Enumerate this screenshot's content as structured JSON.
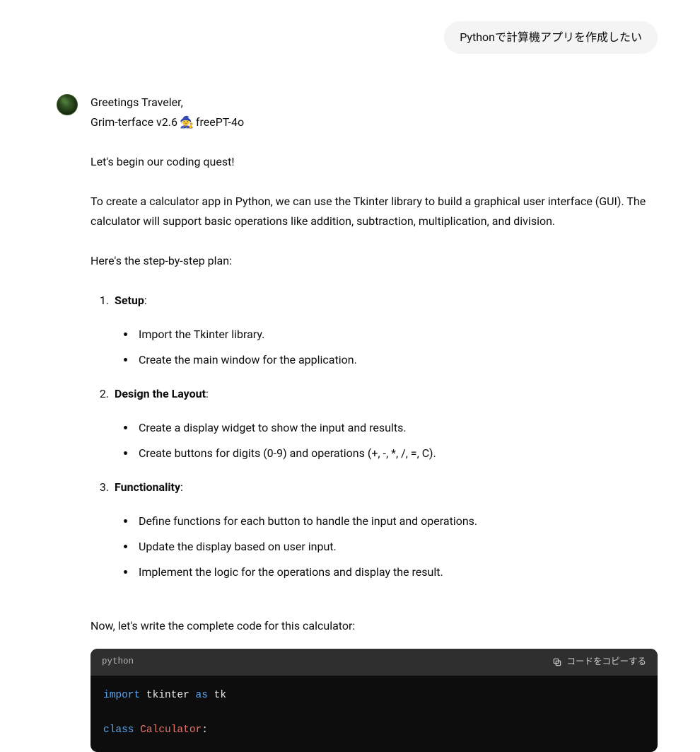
{
  "user": {
    "message": "Pythonで計算機アプリを作成したい"
  },
  "assistant": {
    "greeting_line1": "Greetings Traveler,",
    "greeting_line2_pre": "Grim-terface v2.6 ",
    "greeting_line2_post": " freePT-4o",
    "quest": "Let's begin our coding quest!",
    "intro": "To create a calculator app in Python, we can use the Tkinter library to build a graphical user interface (GUI). The calculator will support basic operations like addition, subtraction, multiplication, and division.",
    "plan_intro": "Here's the step-by-step plan:",
    "steps": [
      {
        "title": "Setup",
        "items": [
          "Import the Tkinter library.",
          "Create the main window for the application."
        ]
      },
      {
        "title": "Design the Layout",
        "items": [
          "Create a display widget to show the input and results.",
          "Create buttons for digits (0-9) and operations (+, -, *, /, =, C)."
        ]
      },
      {
        "title": "Functionality",
        "items": [
          "Define functions for each button to handle the input and operations.",
          "Update the display based on user input.",
          "Implement the logic for the operations and display the result."
        ]
      }
    ],
    "code_intro": "Now, let's write the complete code for this calculator:"
  },
  "code": {
    "language": "python",
    "copy_label": "コードをコピーする",
    "tokens": {
      "import": "import",
      "tkinter": "tkinter",
      "as": "as",
      "tk": "tk",
      "class": "class",
      "Calculator": "Calculator",
      "colon": ":"
    }
  }
}
